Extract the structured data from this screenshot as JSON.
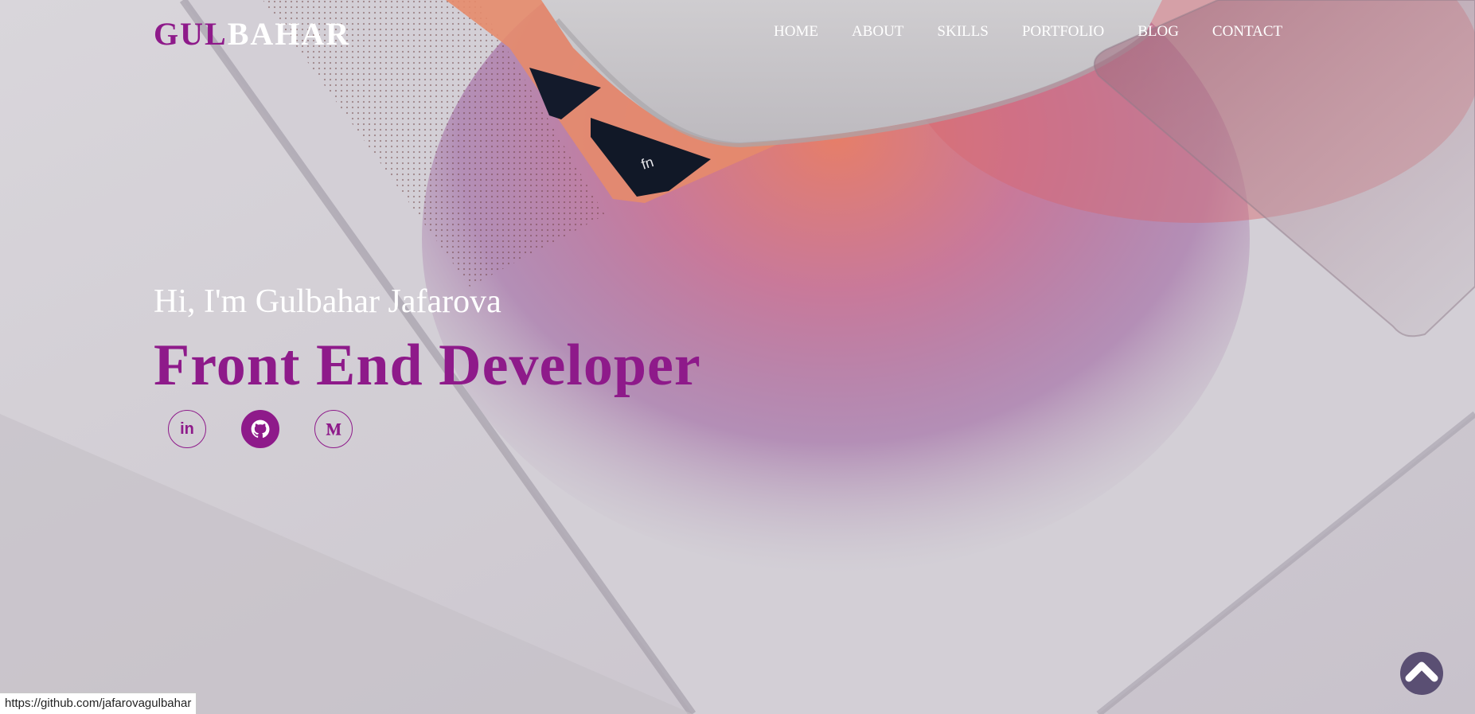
{
  "header": {
    "logo_part_a": "GUL",
    "logo_part_b": "BAHAR",
    "nav": [
      {
        "label": "HOME"
      },
      {
        "label": "ABOUT"
      },
      {
        "label": "SKILLS"
      },
      {
        "label": "PORTFOLIO"
      },
      {
        "label": "BLOG"
      },
      {
        "label": "CONTACT"
      }
    ]
  },
  "hero": {
    "greeting": "Hi, I'm Gulbahar Jafarova",
    "role": "Front End Developer",
    "socials": [
      {
        "icon": "linkedin-icon",
        "label": "in"
      },
      {
        "icon": "github-icon"
      },
      {
        "icon": "medium-icon"
      }
    ]
  },
  "scroll_top": {
    "icon": "chevron-up-icon"
  },
  "status_bar": {
    "url": "https://github.com/jafarovagulbahar"
  },
  "colors": {
    "accent": "#8e1a8a",
    "text_light": "#ffffff",
    "scroll_button": "#5a4f73"
  }
}
